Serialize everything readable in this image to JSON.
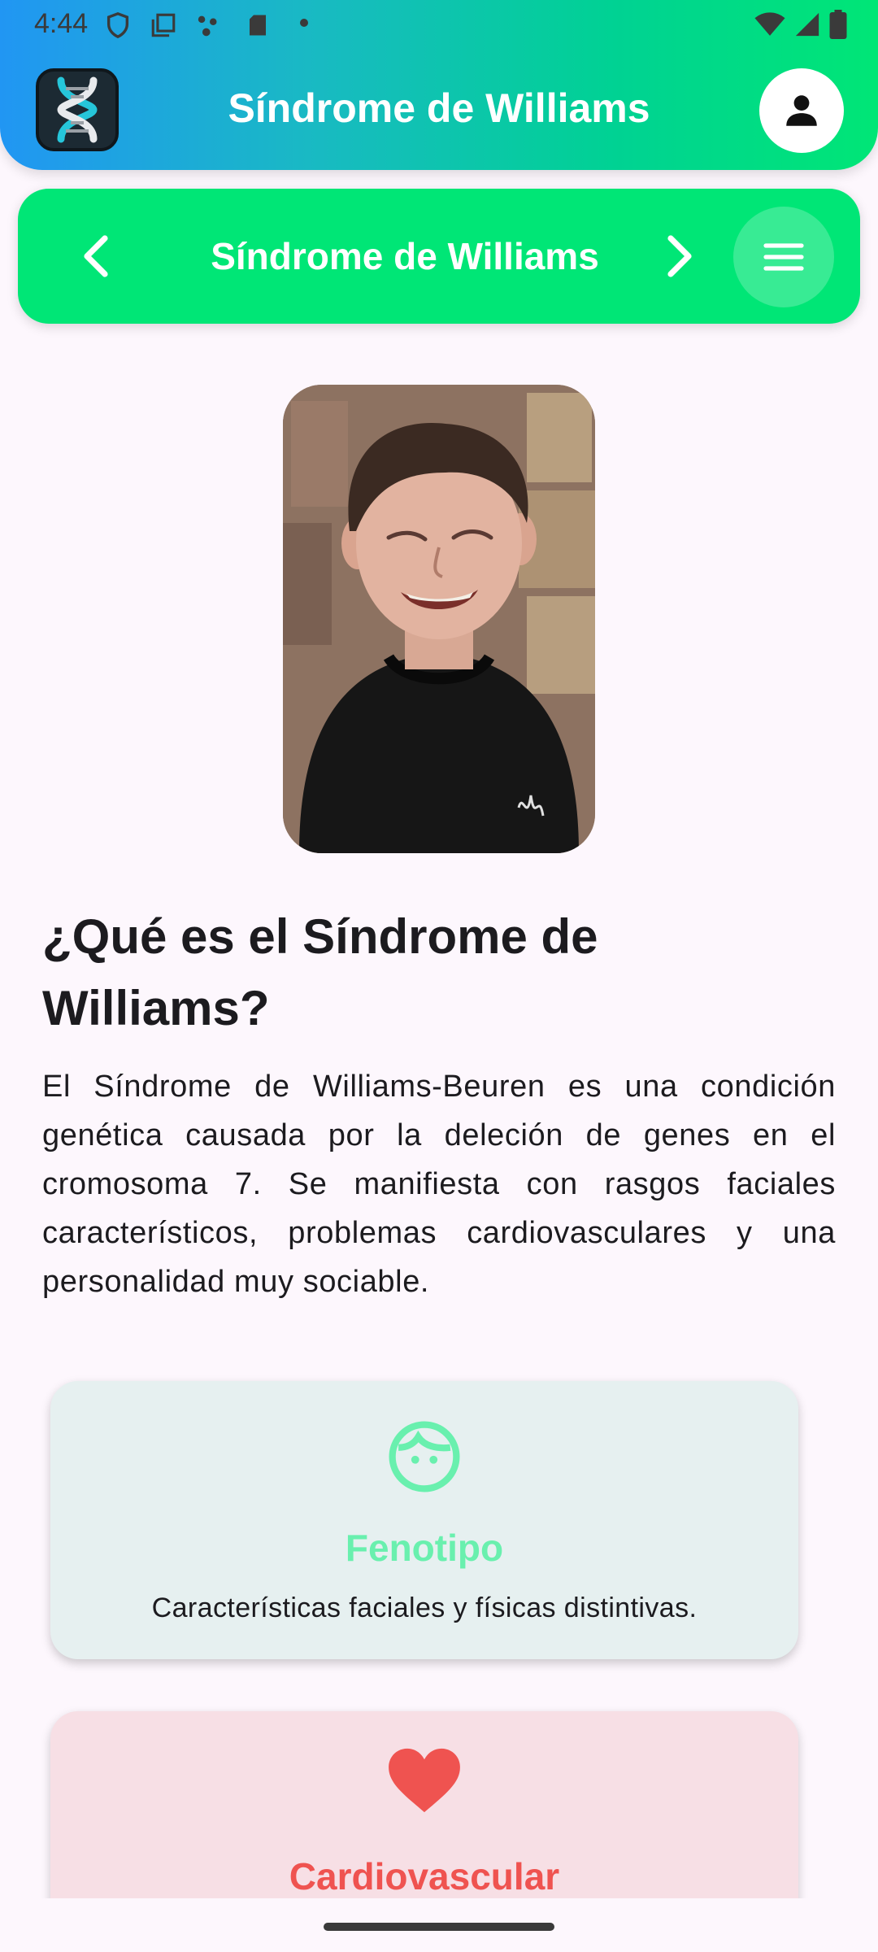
{
  "status_bar": {
    "time": "4:44"
  },
  "app_bar": {
    "title": "Síndrome de Williams"
  },
  "section_nav": {
    "title": "Síndrome de Williams"
  },
  "content": {
    "heading": "¿Qué es el Síndrome de Williams?",
    "description": "El Síndrome de Williams-Beuren es una condición genética causada por la deleción de genes en el cromosoma 7. Se manifiesta con rasgos faciales característicos, problemas cardiovasculares y una personalidad muy sociable."
  },
  "cards": [
    {
      "icon": "face-icon",
      "title": "Fenotipo",
      "text": "Características faciales y físicas distintivas.",
      "background": "#e6f0f0",
      "accent": "#69f0ae"
    },
    {
      "icon": "heart-icon",
      "title": "Cardiovascular",
      "background": "#f7dfe5",
      "accent": "#ef5350"
    }
  ],
  "colors": {
    "nav_green": "#00e676",
    "page_background": "#fdf7fd"
  }
}
